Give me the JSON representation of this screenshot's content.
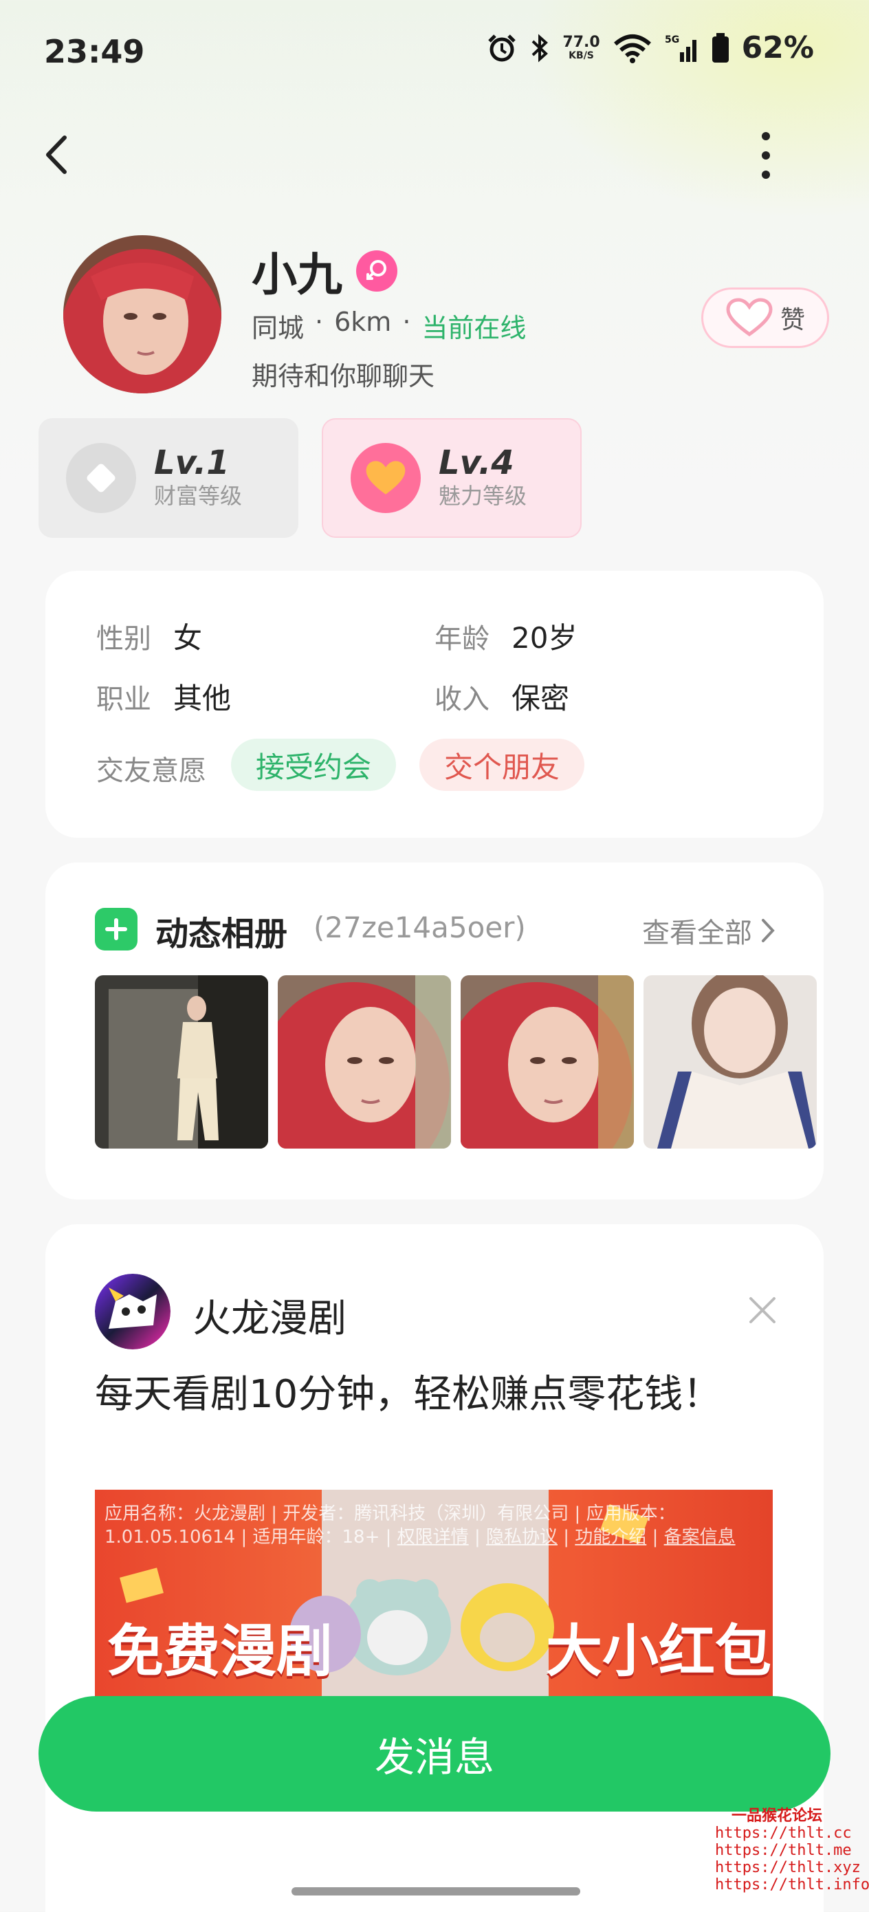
{
  "status_bar": {
    "time": "23:49",
    "net_speed": "77.0",
    "net_unit": "KB/S",
    "signal_label": "5G",
    "battery": "62%"
  },
  "profile": {
    "name": "小九",
    "location": "同城",
    "distance": "6km",
    "online_status": "当前在线",
    "bio": "期待和你聊聊天",
    "like_label": "赞"
  },
  "levels": {
    "wealth": {
      "value": "Lv.1",
      "label": "财富等级"
    },
    "charm": {
      "value": "Lv.4",
      "label": "魅力等级"
    }
  },
  "info": {
    "gender_label": "性别",
    "gender_value": "女",
    "age_label": "年龄",
    "age_value": "20岁",
    "job_label": "职业",
    "job_value": "其他",
    "income_label": "收入",
    "income_value": "保密",
    "intent_label": "交友意愿",
    "intents": [
      "接受约会",
      "交个朋友"
    ]
  },
  "album": {
    "title": "动态相册",
    "id": "(27ze14a5oer)",
    "view_all": "查看全部"
  },
  "ad": {
    "app_name": "火龙漫剧",
    "headline": "每天看剧10分钟，轻松赚点零花钱！",
    "info_prefix": "应用名称：火龙漫剧 | 开发者：腾讯科技（深圳）有限公司 | 应用版本：1.01.05.10614 | 适用年龄：18+ |",
    "link_permissions": "权限详情",
    "link_privacy": "隐私协议",
    "link_features": "功能介绍",
    "link_filing": "备案信息",
    "banner_left": "免费漫剧",
    "banner_right": "大小红包"
  },
  "send_button": "发消息",
  "watermark": {
    "title": "一品猴花论坛",
    "urls": [
      "https://thlt.cc",
      "https://thlt.me",
      "https://thlt.xyz",
      "https://thlt.info"
    ]
  },
  "colors": {
    "accent_green": "#22c865",
    "online_green": "#2db36a",
    "gender_pink": "#ff5aa0"
  }
}
